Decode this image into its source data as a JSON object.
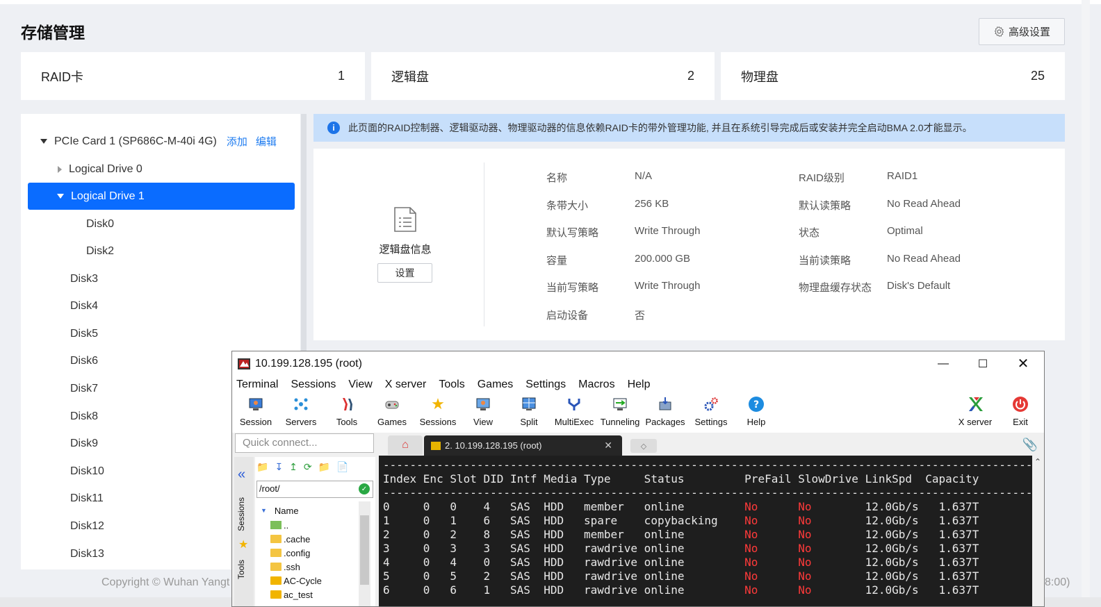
{
  "page": {
    "title": "存储管理",
    "advanced_label": "高级设置"
  },
  "stats": [
    {
      "label": "RAID卡",
      "value": "1"
    },
    {
      "label": "逻辑盘",
      "value": "2"
    },
    {
      "label": "物理盘",
      "value": "25"
    }
  ],
  "tree": {
    "card": "PCIe Card 1 (SP686C-M-40i 4G)",
    "add": "添加",
    "edit": "编辑",
    "ld0": "Logical Drive 0",
    "ld1": "Logical Drive 1",
    "ld1_disks": [
      "Disk0",
      "Disk2"
    ],
    "disks": [
      "Disk3",
      "Disk4",
      "Disk5",
      "Disk6",
      "Disk7",
      "Disk8",
      "Disk9",
      "Disk10",
      "Disk11",
      "Disk12",
      "Disk13"
    ]
  },
  "info_bar": "此页面的RAID控制器、逻辑驱动器、物理驱动器的信息依赖RAID卡的带外管理功能, 并且在系统引导完成后或安装并完全启动BMA 2.0才能显示。",
  "detail": {
    "title": "逻辑盘信息",
    "settings_btn": "设置",
    "left": [
      {
        "k": "名称",
        "v": "N/A"
      },
      {
        "k": "条带大小",
        "v": "256 KB"
      },
      {
        "k": "默认写策略",
        "v": "Write Through"
      },
      {
        "k": "容量",
        "v": "200.000 GB"
      },
      {
        "k": "当前写策略",
        "v": "Write Through"
      },
      {
        "k": "启动设备",
        "v": "否"
      }
    ],
    "right": [
      {
        "k": "RAID级别",
        "v": "RAID1"
      },
      {
        "k": "默认读策略",
        "v": "No Read Ahead"
      },
      {
        "k": "状态",
        "v": "Optimal"
      },
      {
        "k": "当前读策略",
        "v": "No Read Ahead"
      },
      {
        "k": "物理盘缓存状态",
        "v": "Disk's Default"
      }
    ]
  },
  "footer": {
    "left": "Copyright © Wuhan Yangt",
    "right": "8:00)"
  },
  "moba": {
    "title": "10.199.128.195 (root)",
    "menu": [
      "Terminal",
      "Sessions",
      "View",
      "X server",
      "Tools",
      "Games",
      "Settings",
      "Macros",
      "Help"
    ],
    "toolbar": [
      {
        "label": "Session",
        "icon": "session-icon"
      },
      {
        "label": "Servers",
        "icon": "servers-icon"
      },
      {
        "label": "Tools",
        "icon": "tools-icon"
      },
      {
        "label": "Games",
        "icon": "games-icon"
      },
      {
        "label": "Sessions",
        "icon": "star-icon"
      },
      {
        "label": "View",
        "icon": "view-icon"
      },
      {
        "label": "Split",
        "icon": "split-icon"
      },
      {
        "label": "MultiExec",
        "icon": "multiexec-icon"
      },
      {
        "label": "Tunneling",
        "icon": "tunneling-icon"
      },
      {
        "label": "Packages",
        "icon": "packages-icon"
      },
      {
        "label": "Settings",
        "icon": "settings-icon"
      },
      {
        "label": "Help",
        "icon": "help-icon"
      }
    ],
    "xserver": "X server",
    "exit": "Exit",
    "quick_placeholder": "Quick connect...",
    "tab_label": "2. 10.199.128.195 (root)",
    "side_labels": [
      "Sessions",
      "Tools"
    ],
    "path": "/root/",
    "files": {
      "header": "Name",
      "items": [
        "..",
        ".cache",
        ".config",
        ".ssh",
        "AC-Cycle",
        "ac_test"
      ]
    },
    "terminal": {
      "header": [
        "Index",
        "Enc",
        "Slot",
        "DID",
        "Intf",
        "Media",
        "Type",
        "Status",
        "PreFail",
        "SlowDrive",
        "LinkSpd",
        "Capacity"
      ],
      "rows": [
        [
          "0",
          "0",
          "0",
          "4",
          "SAS",
          "HDD",
          "member",
          "online",
          "No",
          "No",
          "12.0Gb/s",
          "1.637T"
        ],
        [
          "1",
          "0",
          "1",
          "6",
          "SAS",
          "HDD",
          "spare",
          "copybacking",
          "No",
          "No",
          "12.0Gb/s",
          "1.637T"
        ],
        [
          "2",
          "0",
          "2",
          "8",
          "SAS",
          "HDD",
          "member",
          "online",
          "No",
          "No",
          "12.0Gb/s",
          "1.637T"
        ],
        [
          "3",
          "0",
          "3",
          "3",
          "SAS",
          "HDD",
          "rawdrive",
          "online",
          "No",
          "No",
          "12.0Gb/s",
          "1.637T"
        ],
        [
          "4",
          "0",
          "4",
          "0",
          "SAS",
          "HDD",
          "rawdrive",
          "online",
          "No",
          "No",
          "12.0Gb/s",
          "1.637T"
        ],
        [
          "5",
          "0",
          "5",
          "2",
          "SAS",
          "HDD",
          "rawdrive",
          "online",
          "No",
          "No",
          "12.0Gb/s",
          "1.637T"
        ],
        [
          "6",
          "0",
          "6",
          "1",
          "SAS",
          "HDD",
          "rawdrive",
          "online",
          "No",
          "No",
          "12.0Gb/s",
          "1.637T"
        ]
      ]
    }
  },
  "colors": {
    "accent": "#0a6cff",
    "link": "#1f7cf0",
    "info_bg": "#c7dffb",
    "terminal_bg": "#1e1e1e",
    "terminal_red": "#ff3a3a"
  }
}
